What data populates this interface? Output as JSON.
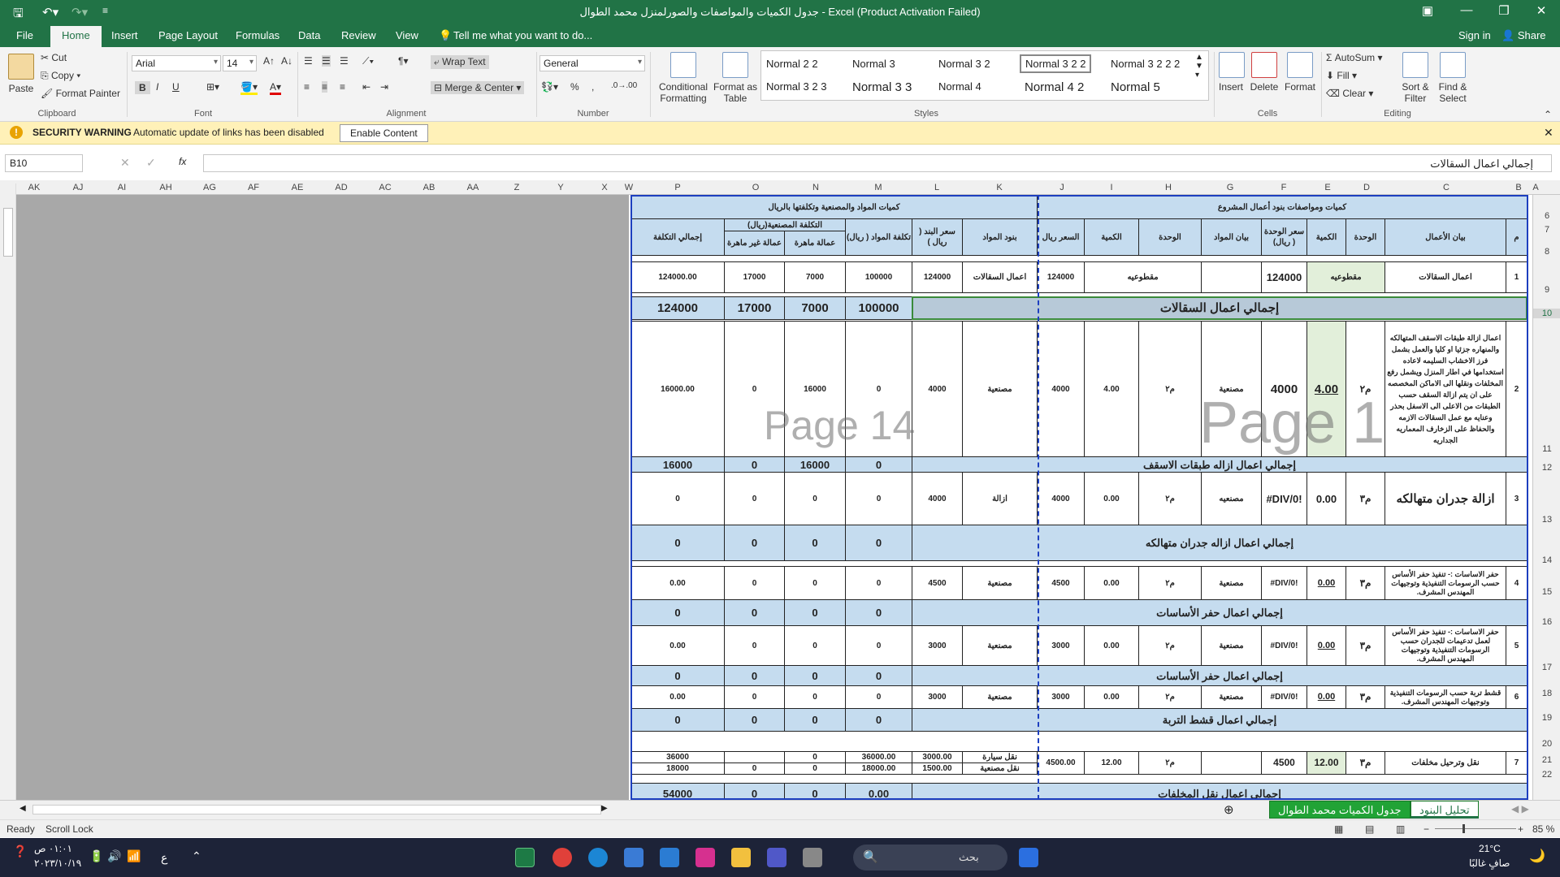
{
  "titlebar": {
    "title": "جدول الكميات  والمواصفات  والصورلمنزل  محمد الطوال - Excel (Product Activation Failed)",
    "save_icon": "save-icon",
    "undo_icon": "undo-icon",
    "redo_icon": "redo-icon"
  },
  "tabs": [
    "File",
    "Home",
    "Insert",
    "Page Layout",
    "Formulas",
    "Data",
    "Review",
    "View"
  ],
  "tell_me": "Tell me what you want to do...",
  "signin": "Sign in",
  "share": "Share",
  "ribbon": {
    "clipboard": {
      "paste": "Paste",
      "cut": "Cut",
      "copy": "Copy",
      "format_painter": "Format Painter",
      "label": "Clipboard"
    },
    "font": {
      "name": "Arial",
      "size": "14",
      "bold": "B",
      "italic": "I",
      "underline": "U",
      "label": "Font"
    },
    "alignment": {
      "wrap": "Wrap Text",
      "merge": "Merge & Center",
      "label": "Alignment"
    },
    "number": {
      "format": "General",
      "percent": "%",
      "comma": ",",
      "label": "Number"
    },
    "styles": {
      "conditional": "Conditional Formatting",
      "format_table": "Format as Table",
      "gallery": [
        "Normal 2 2",
        "Normal 3",
        "Normal 3 2",
        "Normal 3 2 2",
        "Normal 3 2 2 2",
        "Normal 3 2 3",
        "Normal 3 3",
        "Normal 4",
        "Normal 4 2",
        "Normal 5"
      ],
      "label": "Styles"
    },
    "cells": {
      "insert": "Insert",
      "delete": "Delete",
      "format": "Format",
      "label": "Cells"
    },
    "editing": {
      "autosum": "AutoSum",
      "fill": "Fill",
      "clear": "Clear",
      "sort": "Sort & Filter",
      "find": "Find & Select",
      "label": "Editing"
    }
  },
  "security": {
    "title": "SECURITY WARNING",
    "message": "Automatic update of links has been disabled",
    "button": "Enable Content"
  },
  "formula_bar": {
    "name_box": "B10",
    "fx": "fx",
    "value": "إجمالي اعمال السقالات"
  },
  "columns_left": [
    "AK",
    "AJ",
    "AI",
    "AH",
    "AG",
    "AF",
    "AE",
    "AD",
    "AC",
    "AB",
    "AA",
    "Z",
    "Y",
    "X",
    "W"
  ],
  "columns_right": [
    "P",
    "O",
    "N",
    "M",
    "L",
    "K",
    "J",
    "I",
    "H",
    "G",
    "F",
    "E",
    "D",
    "C",
    "B",
    "A"
  ],
  "rows": [
    "6",
    "7",
    "8",
    "9",
    "10",
    "11",
    "12",
    "13",
    "14",
    "15",
    "16",
    "17",
    "18",
    "19",
    "20",
    "21",
    "22"
  ],
  "sheet": {
    "hdr_left": "كميات المواد والمصنعية وتكلفتها بالريال",
    "hdr_right": "كميات ومواصفات بنود أعمال المشروع",
    "hdr_labor": "التكلفة المصنعية(ريال)",
    "h_total": "إجمالي التكلفة",
    "h_unskilled": "عمالة غير ماهرة",
    "h_skilled": "عمالة ماهرة",
    "h_matcost": "تكلفة المواد ( ريال)",
    "h_itemprice": "سعر البند ( ريال )",
    "h_matitems": "بنود المواد",
    "h_price": "السعر ريال",
    "h_qty": "الكمية",
    "h_unit": "الوحدة",
    "h_matdesc": "بيان المواد",
    "h_unitprice": "سعر الوحدة ( ريال)",
    "h_qty2": "الكمية",
    "h_unit2": "الوحدة",
    "h_workdesc": "بيان الأعمال",
    "h_no": "م",
    "r1": {
      "total": "124000.00",
      "unskilled": "17000",
      "skilled": "7000",
      "matcost": "100000",
      "itemprice": "124000",
      "matitems": "اعمال السقالات",
      "price": "124000",
      "lump": "مقطوعيه",
      "unitprice": "124000",
      "lump2": "مقطوعيه",
      "desc": "اعمال السقالات",
      "no": "1"
    },
    "t1": {
      "total": "124000",
      "unskilled": "17000",
      "skilled": "7000",
      "matcost": "100000",
      "label": "إجمالي اعمال السقالات"
    },
    "r2": {
      "total": "16000.00",
      "unskilled": "0",
      "skilled": "16000",
      "matcost": "0",
      "itemprice": "4000",
      "matitems": "مصنعية",
      "price": "4000",
      "qty": "4.00",
      "unit": "م٢",
      "matdesc": "مصنعية",
      "unitprice": "4000",
      "qty2": "4.00",
      "unit2": "م٢",
      "no": "2",
      "desc": "اعمال ازالة طبقات الاسقف المتهالكه والمنهاره جزئيا او كليا والعمل بشمل فرز الاخشاب السليمه لاعاده استخدامها في اطار المنزل ويشمل رفع المخلفات ونقلها الى الاماكن المخصصه على ان يتم ازالة السقف حسب الطبقات من الاعلى الى الاسفل بحذر وعنايه مع عمل السقالات الازمه والحفاظ على الزخارف المعماريه الجداريه"
    },
    "t2": {
      "total": "16000",
      "unskilled": "0",
      "skilled": "16000",
      "matcost": "0",
      "label": "إجمالي اعمال ازاله طبقات الاسقف"
    },
    "r3": {
      "total": "0",
      "unskilled": "0",
      "skilled": "0",
      "matcost": "0",
      "itemprice": "4000",
      "matitems": "ازالة",
      "price": "4000",
      "qty": "0.00",
      "unit": "م٢",
      "matdesc": "مصنعيه",
      "unitprice": "#DIV/0!",
      "qty2": "0.00",
      "unit2": "م٣",
      "desc": "ازالة جدران متهالكه",
      "no": "3"
    },
    "t3": {
      "total": "0",
      "unskilled": "0",
      "skilled": "0",
      "matcost": "0",
      "label": "إجمالي اعمال ازاله جدران متهالكه"
    },
    "r4": {
      "total": "0.00",
      "unskilled": "0",
      "skilled": "0",
      "matcost": "0",
      "itemprice": "4500",
      "matitems": "مصنعية",
      "price": "4500",
      "qty": "0.00",
      "unit": "م٢",
      "matdesc": "مصنعية",
      "unitprice": "#DIV/0!",
      "qty2": "0.00",
      "unit2": "م٣",
      "desc": "حفر الاساسات :- تنفيذ حفر الأساس حسب الرسومات التنفيذية وتوجيهات المهندس المشرف.",
      "no": "4"
    },
    "t4": {
      "total": "0",
      "unskilled": "0",
      "skilled": "0",
      "matcost": "0",
      "label": "إجمالي اعمال حفر الأساسات"
    },
    "r5": {
      "total": "0.00",
      "unskilled": "0",
      "skilled": "0",
      "matcost": "0",
      "itemprice": "3000",
      "matitems": "مصنعية",
      "price": "3000",
      "qty": "0.00",
      "unit": "م٢",
      "matdesc": "مصنعية",
      "unitprice": "#DIV/0!",
      "qty2": "0.00",
      "unit2": "م٣",
      "desc": "حفر الاساسات :- تنفيذ حفر الأساس لعمل تدعيمات للجدران حسب الرسومات التنفيذية وتوجيهات المهندس المشرف.",
      "no": "5"
    },
    "t5": {
      "total": "0",
      "unskilled": "0",
      "skilled": "0",
      "matcost": "0",
      "label": "إجمالي اعمال حفر الأساسات"
    },
    "r6": {
      "total": "0.00",
      "unskilled": "0",
      "skilled": "0",
      "matcost": "0",
      "itemprice": "3000",
      "matitems": "مصنعية",
      "price": "3000",
      "qty": "0.00",
      "unit": "م٢",
      "matdesc": "مصنعية",
      "unitprice": "#DIV/0!",
      "qty2": "0.00",
      "unit2": "م٣",
      "desc": "قشط تربة حسب الرسومات التنفيذية وتوجيهات المهندس المشرف.",
      "no": "6"
    },
    "t6": {
      "total": "0",
      "unskilled": "0",
      "skilled": "0",
      "matcost": "0",
      "label": "إجمالي اعمال قشط التربة"
    },
    "r7a": {
      "total": "36000",
      "unskilled": "",
      "skilled": "0",
      "matcost": "36000.00",
      "itemprice": "3000.00",
      "matitems": "نقل سيارة"
    },
    "r7b": {
      "total": "18000",
      "unskilled": "0",
      "skilled": "0",
      "matcost": "18000.00",
      "itemprice": "1500.00",
      "matitems": "نقل مصنعية"
    },
    "r7": {
      "price": "4500.00",
      "qty": "12.00",
      "unit": "م٢",
      "unitprice": "4500",
      "qty2": "12.00",
      "unit2": "م٣",
      "desc": "نقل وترحيل مخلفات",
      "no": "7"
    },
    "t7": {
      "total": "54000",
      "unskilled": "0",
      "skilled": "0",
      "matcost": "0.00",
      "label": "إجمالي اعمال نقل المخلفات"
    },
    "watermark_a": "Page 14",
    "watermark_b": "Page 1"
  },
  "sheet_tabs": [
    "تحليل البنود",
    "جدول الكميات محمد الطوال"
  ],
  "status": {
    "ready": "Ready",
    "scroll_lock": "Scroll Lock",
    "zoom": "85 %"
  },
  "taskbar": {
    "weather_temp": "21°C",
    "weather_desc": "صافٍ غالبًا",
    "search_placeholder": "بحث",
    "time": "٠١:٠١ ص",
    "date": "٢٠٢٣/١٠/١٩",
    "lang": "ع"
  },
  "colors": {
    "excel_green": "#217346",
    "header_blue": "#c5dcef",
    "light_green": "#e2efda",
    "page_border": "#1d3fbf"
  }
}
